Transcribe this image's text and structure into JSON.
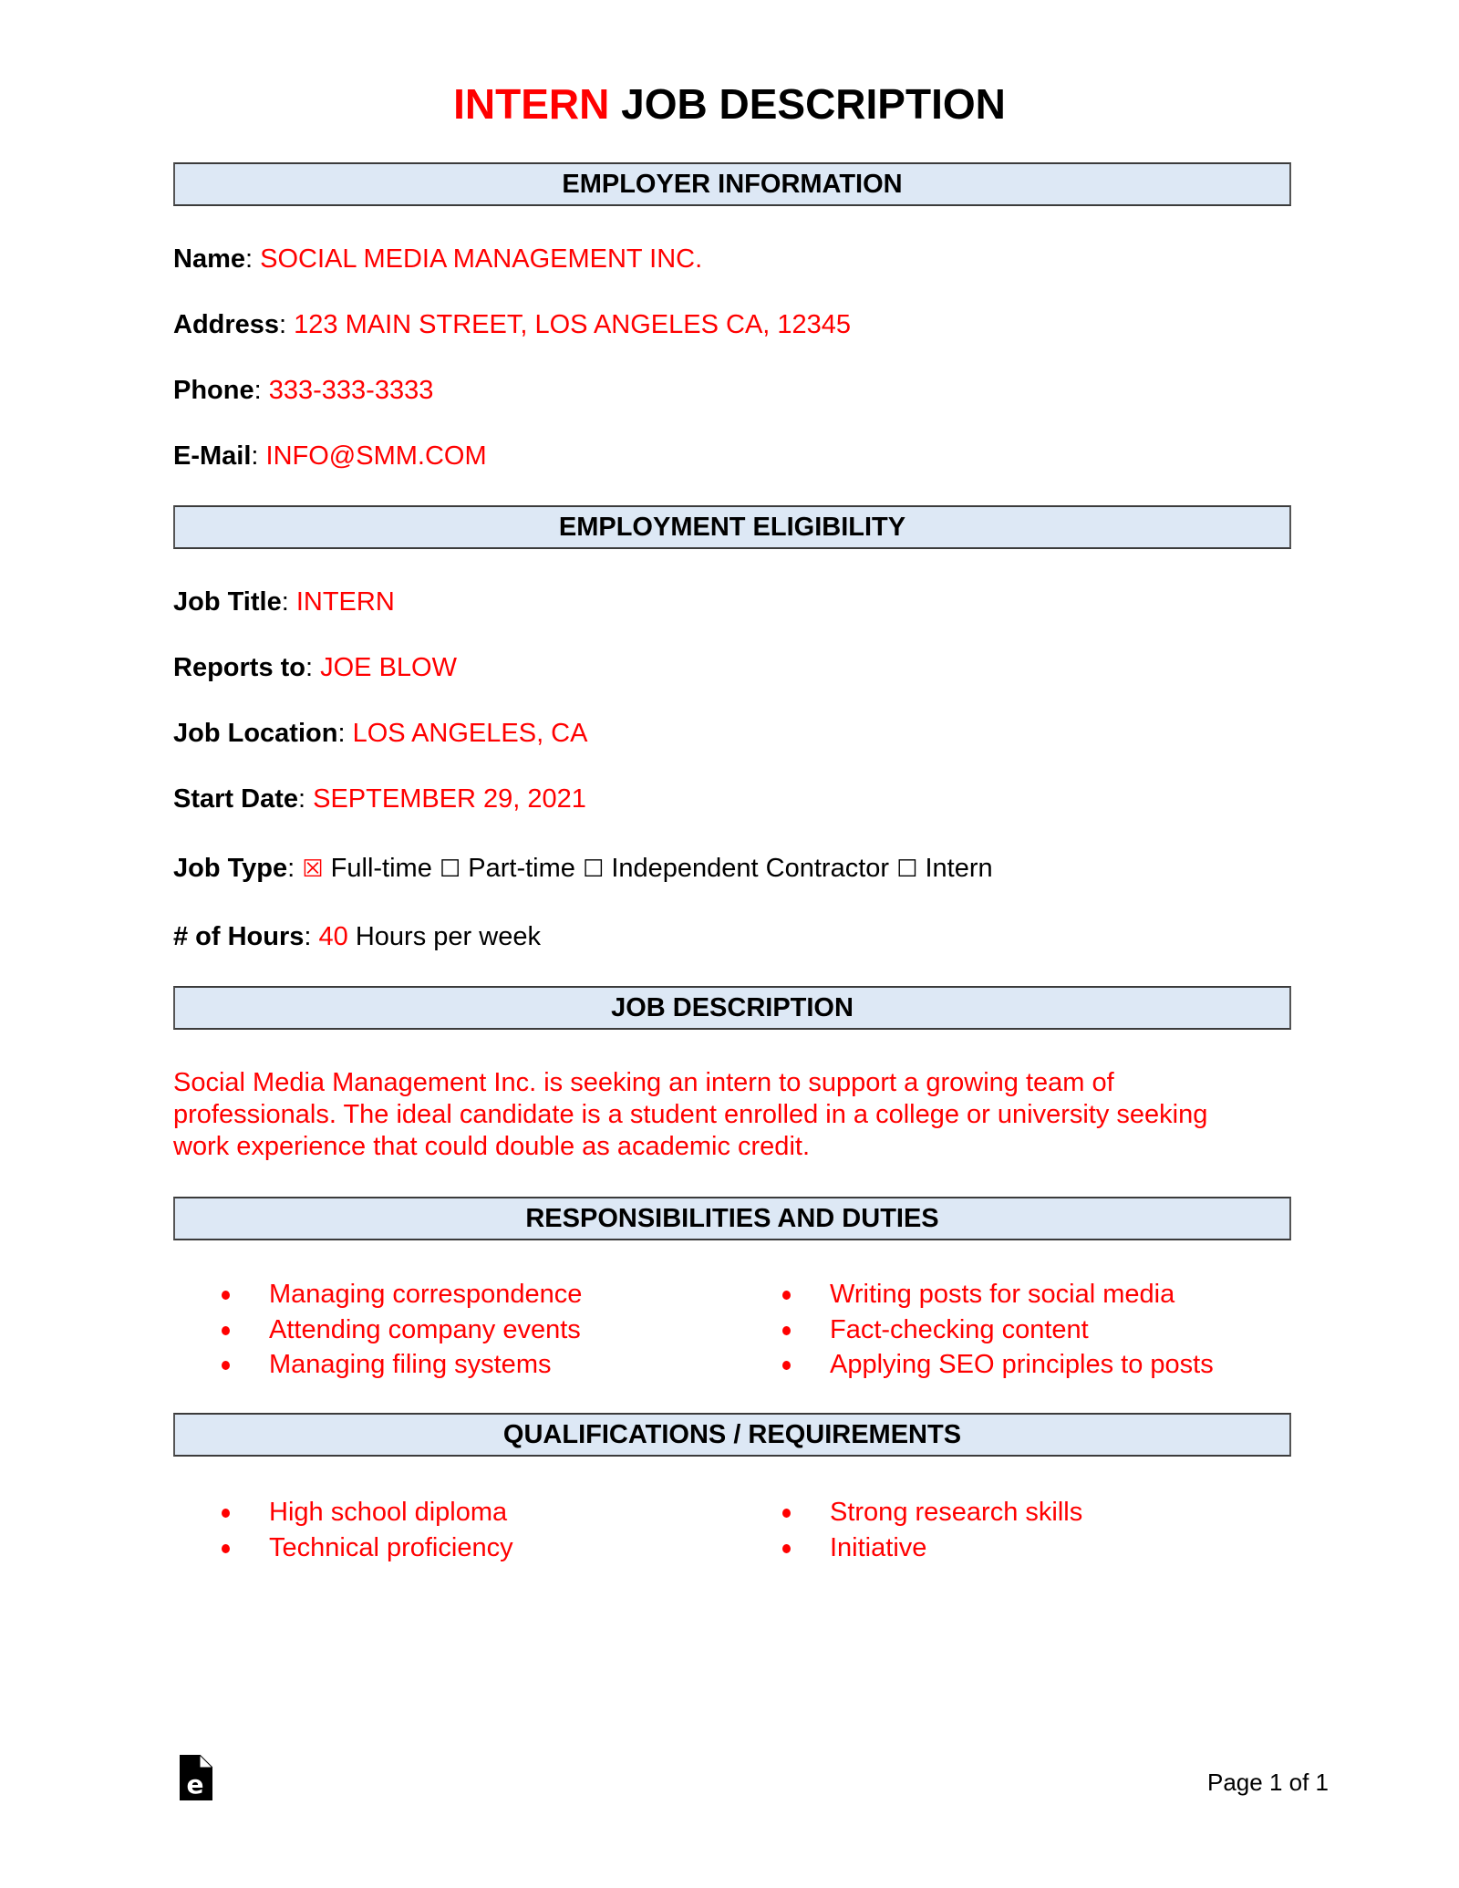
{
  "document": {
    "title": {
      "highlight": "INTERN",
      "rest": " JOB DESCRIPTION"
    },
    "sections": {
      "employer": "EMPLOYER INFORMATION",
      "eligibility": "EMPLOYMENT ELIGIBILITY",
      "description": "JOB DESCRIPTION",
      "responsibilities": "RESPONSIBILITIES AND DUTIES",
      "qualifications": "QUALIFICATIONS / REQUIREMENTS"
    },
    "employer": {
      "name": {
        "label": "Name",
        "value": "SOCIAL MEDIA MANAGEMENT INC."
      },
      "address": {
        "label": "Address",
        "value": "123 MAIN STREET, LOS ANGELES CA, 12345"
      },
      "phone": {
        "label": "Phone",
        "value": "333-333-3333"
      },
      "email": {
        "label": "E-Mail",
        "value": "INFO@SMM.COM"
      }
    },
    "eligibility": {
      "job_title": {
        "label": "Job Title",
        "value": "INTERN"
      },
      "reports_to": {
        "label": "Reports to",
        "value": "JOE BLOW"
      },
      "job_location": {
        "label": "Job Location",
        "value": "LOS ANGELES, CA"
      },
      "start_date": {
        "label": "Start Date",
        "value": "SEPTEMBER 29, 2021"
      },
      "job_type": {
        "label": "Job Type",
        "options": [
          {
            "label": "Full-time",
            "checked": true,
            "glyph": "☒"
          },
          {
            "label": "Part-time",
            "checked": false,
            "glyph": "☐"
          },
          {
            "label": "Independent Contractor",
            "checked": false,
            "glyph": "☐"
          },
          {
            "label": "Intern",
            "checked": false,
            "glyph": "☐"
          }
        ]
      },
      "hours": {
        "label": "# of Hours",
        "value": "40",
        "suffix": "Hours per week"
      }
    },
    "description_text": "Social Media Management Inc. is seeking an intern to support a growing team of professionals. The ideal candidate is a student enrolled in a college or university seeking work experience that could double as academic credit.",
    "responsibilities": {
      "left": [
        "Managing correspondence",
        "Attending company events",
        "Managing filing systems"
      ],
      "right": [
        "Writing posts for social media",
        "Fact-checking content",
        "Applying SEO principles to posts"
      ]
    },
    "qualifications": {
      "left": [
        "High school diploma",
        "Technical proficiency"
      ],
      "right": [
        "Strong research skills",
        "Initiative"
      ]
    },
    "footer": {
      "logo_icon": "eforms-document-icon",
      "page_label": "Page 1 of 1"
    },
    "colors": {
      "accent": "#ff0000",
      "section_fill": "#dde8f5",
      "section_border": "#3b3b3b"
    }
  }
}
